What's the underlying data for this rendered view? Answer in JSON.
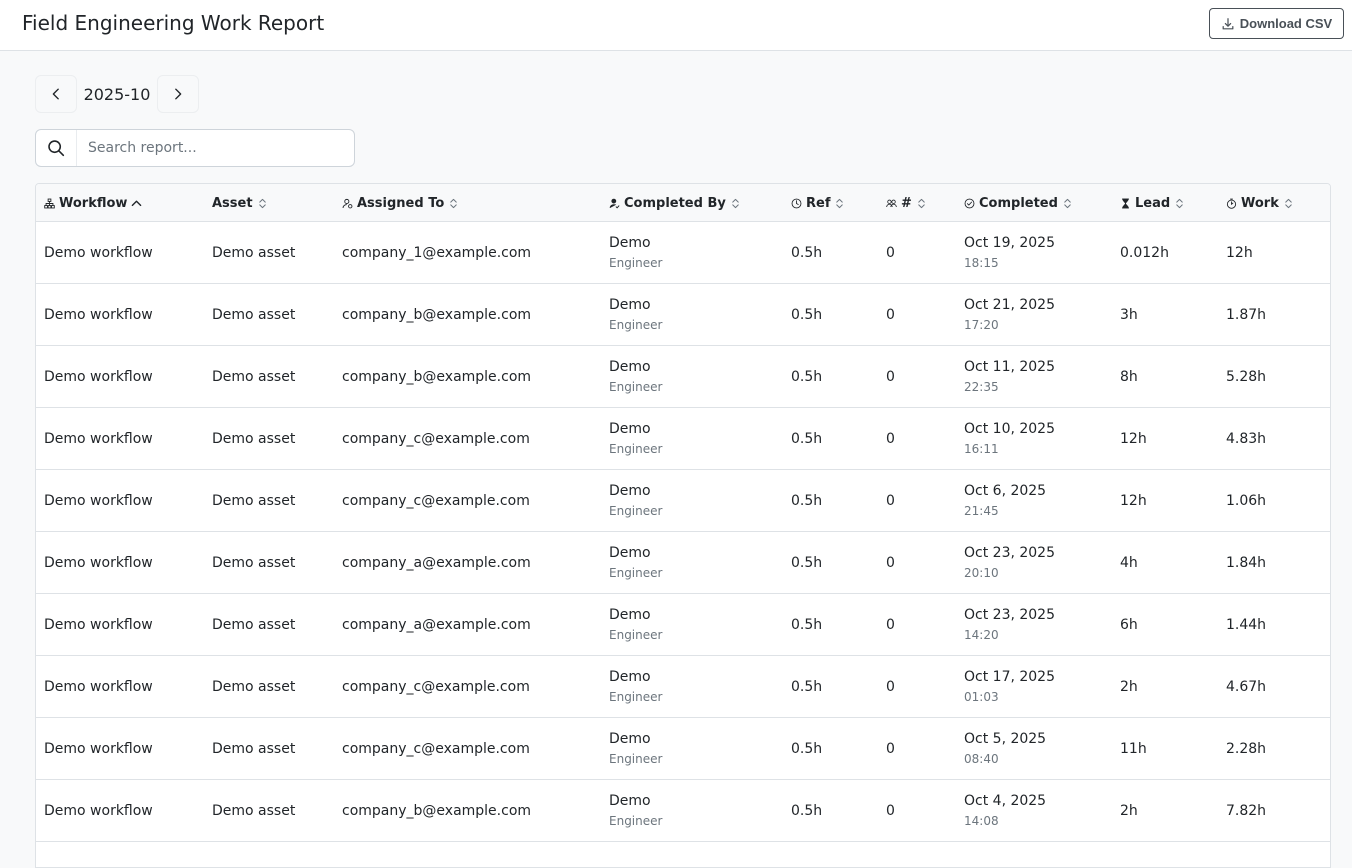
{
  "header": {
    "title": "Field Engineering Work Report",
    "download_label": "Download CSV"
  },
  "period": {
    "month": "2025-10"
  },
  "search": {
    "placeholder": "Search report..."
  },
  "table": {
    "columns": [
      {
        "key": "workflow",
        "label": "Workflow",
        "icon": "workflow-icon",
        "sort": "asc"
      },
      {
        "key": "asset",
        "label": "Asset",
        "icon": "",
        "sort": "none"
      },
      {
        "key": "assigned_to",
        "label": "Assigned To",
        "icon": "user-icon",
        "sort": "none"
      },
      {
        "key": "completed_by",
        "label": "Completed By",
        "icon": "user-check-icon",
        "sort": "none"
      },
      {
        "key": "ref",
        "label": "Ref",
        "icon": "clock-icon",
        "sort": "none"
      },
      {
        "key": "count",
        "label": "#",
        "icon": "users-icon",
        "sort": "none"
      },
      {
        "key": "completed",
        "label": "Completed",
        "icon": "check-circle-icon",
        "sort": "none"
      },
      {
        "key": "lead",
        "label": "Lead",
        "icon": "hourglass-icon",
        "sort": "none"
      },
      {
        "key": "work",
        "label": "Work",
        "icon": "stopwatch-icon",
        "sort": "none"
      }
    ],
    "rows": [
      {
        "workflow": "Demo workflow",
        "asset": "Demo asset",
        "assigned_to": "company_1@example.com",
        "completed_by_name": "Demo",
        "completed_by_role": "Engineer",
        "ref": "0.5h",
        "count": "0",
        "completed_date": "Oct 19, 2025",
        "completed_time": "18:15",
        "lead": "0.012h",
        "work": "12h"
      },
      {
        "workflow": "Demo workflow",
        "asset": "Demo asset",
        "assigned_to": "company_b@example.com",
        "completed_by_name": "Demo",
        "completed_by_role": "Engineer",
        "ref": "0.5h",
        "count": "0",
        "completed_date": "Oct 21, 2025",
        "completed_time": "17:20",
        "lead": "3h",
        "work": "1.87h"
      },
      {
        "workflow": "Demo workflow",
        "asset": "Demo asset",
        "assigned_to": "company_b@example.com",
        "completed_by_name": "Demo",
        "completed_by_role": "Engineer",
        "ref": "0.5h",
        "count": "0",
        "completed_date": "Oct 11, 2025",
        "completed_time": "22:35",
        "lead": "8h",
        "work": "5.28h"
      },
      {
        "workflow": "Demo workflow",
        "asset": "Demo asset",
        "assigned_to": "company_c@example.com",
        "completed_by_name": "Demo",
        "completed_by_role": "Engineer",
        "ref": "0.5h",
        "count": "0",
        "completed_date": "Oct 10, 2025",
        "completed_time": "16:11",
        "lead": "12h",
        "work": "4.83h"
      },
      {
        "workflow": "Demo workflow",
        "asset": "Demo asset",
        "assigned_to": "company_c@example.com",
        "completed_by_name": "Demo",
        "completed_by_role": "Engineer",
        "ref": "0.5h",
        "count": "0",
        "completed_date": "Oct 6, 2025",
        "completed_time": "21:45",
        "lead": "12h",
        "work": "1.06h"
      },
      {
        "workflow": "Demo workflow",
        "asset": "Demo asset",
        "assigned_to": "company_a@example.com",
        "completed_by_name": "Demo",
        "completed_by_role": "Engineer",
        "ref": "0.5h",
        "count": "0",
        "completed_date": "Oct 23, 2025",
        "completed_time": "20:10",
        "lead": "4h",
        "work": "1.84h"
      },
      {
        "workflow": "Demo workflow",
        "asset": "Demo asset",
        "assigned_to": "company_a@example.com",
        "completed_by_name": "Demo",
        "completed_by_role": "Engineer",
        "ref": "0.5h",
        "count": "0",
        "completed_date": "Oct 23, 2025",
        "completed_time": "14:20",
        "lead": "6h",
        "work": "1.44h"
      },
      {
        "workflow": "Demo workflow",
        "asset": "Demo asset",
        "assigned_to": "company_c@example.com",
        "completed_by_name": "Demo",
        "completed_by_role": "Engineer",
        "ref": "0.5h",
        "count": "0",
        "completed_date": "Oct 17, 2025",
        "completed_time": "01:03",
        "lead": "2h",
        "work": "4.67h"
      },
      {
        "workflow": "Demo workflow",
        "asset": "Demo asset",
        "assigned_to": "company_c@example.com",
        "completed_by_name": "Demo",
        "completed_by_role": "Engineer",
        "ref": "0.5h",
        "count": "0",
        "completed_date": "Oct 5, 2025",
        "completed_time": "08:40",
        "lead": "11h",
        "work": "2.28h"
      },
      {
        "workflow": "Demo workflow",
        "asset": "Demo asset",
        "assigned_to": "company_b@example.com",
        "completed_by_name": "Demo",
        "completed_by_role": "Engineer",
        "ref": "0.5h",
        "count": "0",
        "completed_date": "Oct 4, 2025",
        "completed_time": "14:08",
        "lead": "2h",
        "work": "7.82h"
      }
    ]
  },
  "colors": {
    "text": "#212529",
    "muted": "#6c757d",
    "border": "#dee2e6",
    "page_bg": "#f8f9fa"
  }
}
